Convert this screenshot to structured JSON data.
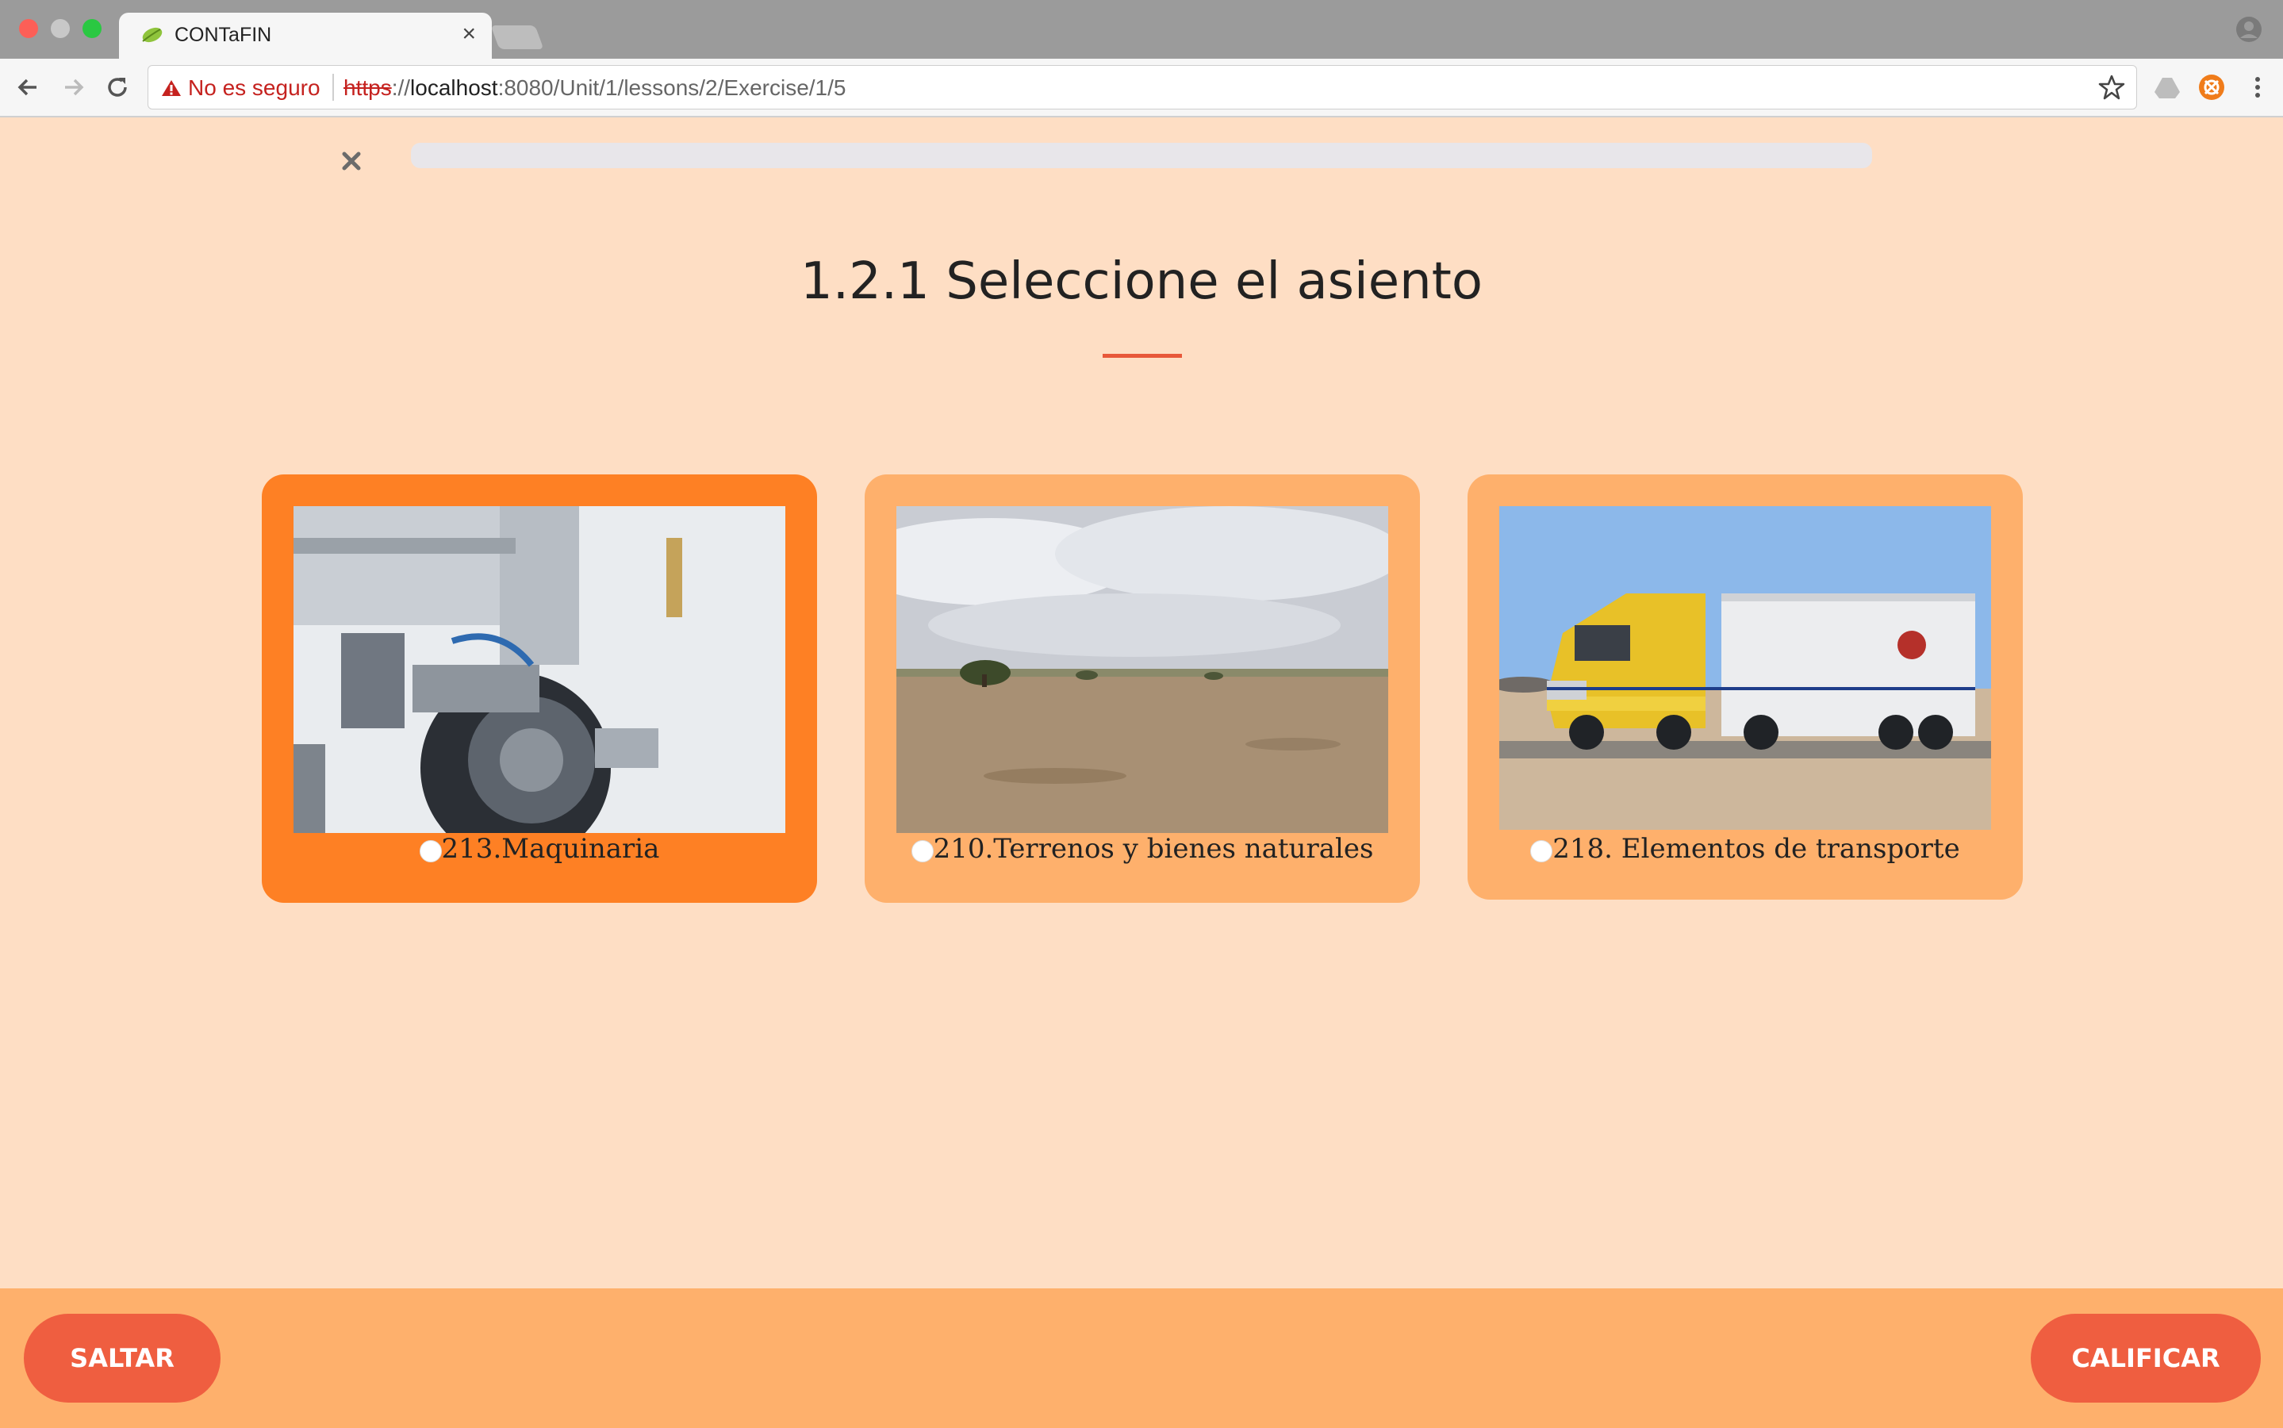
{
  "browser": {
    "tab_title": "CONTaFIN",
    "security_text": "No es seguro",
    "url_scheme": "https",
    "url_sep": "://",
    "url_host": "localhost",
    "url_rest": ":8080/Unit/1/lessons/2/Exercise/1/5"
  },
  "lesson": {
    "progress": 0,
    "title": "1.2.1 Seleccione el asiento"
  },
  "options": [
    {
      "label": "213.Maquinaria",
      "selected": true
    },
    {
      "label": "210.Terrenos y bienes naturales",
      "selected": false
    },
    {
      "label": "218. Elementos de transporte",
      "selected": false
    }
  ],
  "footer": {
    "skip_label": "SALTAR",
    "grade_label": "CALIFICAR"
  },
  "colors": {
    "page_bg": "#fedec4",
    "card_bg": "#feb06c",
    "card_selected_bg": "#fe8024",
    "button_bg": "#ef5e40",
    "accent_rule": "#e8583a"
  },
  "icons": {
    "close": "close-icon",
    "warning": "warning-icon",
    "bookmark": "star-icon",
    "menu": "kebab-menu-icon"
  }
}
